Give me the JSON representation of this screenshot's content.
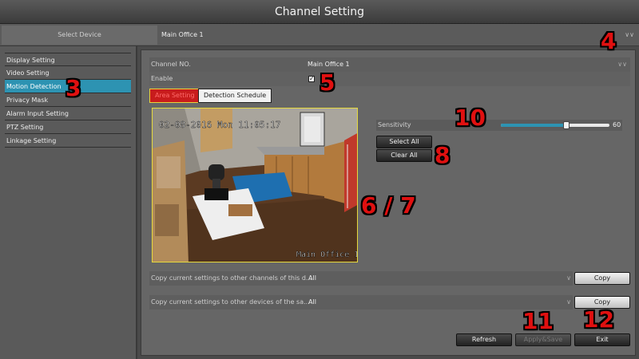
{
  "window": {
    "title": "Channel Setting"
  },
  "device": {
    "label": "Select Device",
    "value": "Main Office 1"
  },
  "sidebar": {
    "items": [
      {
        "label": "Display Setting"
      },
      {
        "label": "Video Setting"
      },
      {
        "label": "Motion Detection"
      },
      {
        "label": "Privacy Mask"
      },
      {
        "label": "Alarm Input Setting"
      },
      {
        "label": "PTZ Setting"
      },
      {
        "label": "Linkage Setting"
      }
    ],
    "active_index": 2
  },
  "channel": {
    "label": "Channel NO.",
    "value": "Main Office 1"
  },
  "enable": {
    "label": "Enable",
    "checked": true
  },
  "tabs": [
    {
      "label": "Area Setting",
      "active": true
    },
    {
      "label": "Detection Schedule",
      "active": false
    }
  ],
  "video": {
    "timestamp": "02-08-2016 Mon 11:05:17",
    "channel_name": "Main Office 1"
  },
  "sensitivity": {
    "label": "Sensitivity",
    "value": 60,
    "max": 100
  },
  "buttons": {
    "select_all": "Select All",
    "clear_all": "Clear All",
    "copy": "Copy",
    "refresh": "Refresh",
    "apply_save": "Apply&Save",
    "exit": "Exit"
  },
  "copy_channels": {
    "label": "Copy current settings to other channels of this d...",
    "value": "All"
  },
  "copy_devices": {
    "label": "Copy current settings to other devices of the sa...",
    "value": "All"
  },
  "annotations": [
    "3",
    "4",
    "5",
    "6 / 7",
    "8",
    "10",
    "11",
    "12"
  ],
  "colors": {
    "accent": "#2d93b2",
    "annotation": "#e01010",
    "tab_active": "#c81c1c"
  }
}
